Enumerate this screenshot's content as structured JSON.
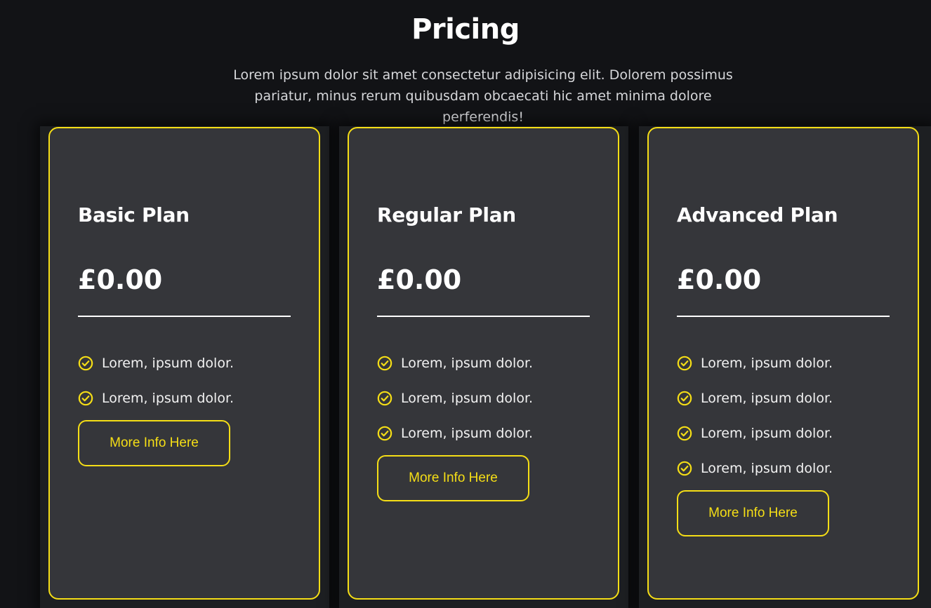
{
  "header": {
    "title": "Pricing",
    "intro": "Lorem ipsum dolor sit amet consectetur adipisicing elit. Dolorem possimus pariatur, minus rerum quibusdam obcaecati hic amet minima dolore perferendis!"
  },
  "colors": {
    "background": "#121316",
    "card": "#35363a",
    "accent": "#f5de16",
    "text": "#ffffff"
  },
  "plans": [
    {
      "name": "Basic Plan",
      "price": "£0.00",
      "features": [
        "Lorem, ipsum dolor.",
        "Lorem, ipsum dolor."
      ],
      "button_label": "More Info Here"
    },
    {
      "name": "Regular Plan",
      "price": "£0.00",
      "features": [
        "Lorem, ipsum dolor.",
        "Lorem, ipsum dolor.",
        "Lorem, ipsum dolor."
      ],
      "button_label": "More Info Here"
    },
    {
      "name": "Advanced Plan",
      "price": "£0.00",
      "features": [
        "Lorem, ipsum dolor.",
        "Lorem, ipsum dolor.",
        "Lorem, ipsum dolor.",
        "Lorem, ipsum dolor."
      ],
      "button_label": "More Info Here"
    }
  ],
  "icons": {
    "feature_bullet": "check-circle-icon"
  }
}
